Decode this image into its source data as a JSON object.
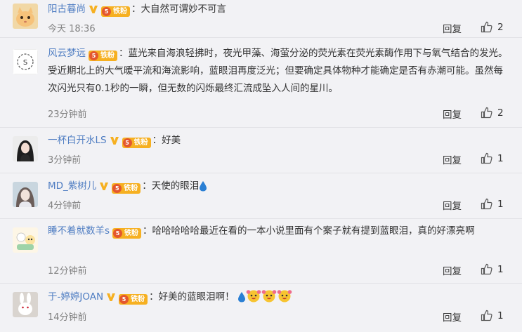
{
  "comments": [
    {
      "user": "阳古暮尚",
      "fan_label": "铁粉",
      "fan_level": "5",
      "text": "大自然可谓妙不可言",
      "time": "今天 18:36",
      "reply_label": "回复",
      "likes": "2",
      "avatar_icon": "cat-avatar"
    },
    {
      "user": "风云梦远",
      "fan_label": "铁粉",
      "fan_level": "5",
      "text": "蓝光来自海浪轻拂时，夜光甲藻、海萤分泌的荧光素在荧光素酶作用下与氧气结合的发光。受近期北上的大气暖平流和海流影响，蓝眼泪再度泛光；但要确定具体物种才能确定是否有赤潮可能。虽然每次闪光只有0.1秒的一瞬，但无数的闪烁最终汇流成坠入人间的星川。",
      "time": "23分钟前",
      "reply_label": "回复",
      "likes": "2",
      "avatar_icon": "logo-avatar"
    },
    {
      "user": "一杯白开水LS",
      "fan_label": "铁粉",
      "fan_level": "5",
      "text": "好美",
      "time": "3分钟前",
      "reply_label": "回复",
      "likes": "1",
      "avatar_icon": "girl-avatar"
    },
    {
      "user": "MD_紫树儿",
      "fan_label": "铁粉",
      "fan_level": "5",
      "text": "天使的眼泪",
      "time": "4分钟前",
      "reply_label": "回复",
      "likes": "1",
      "avatar_icon": "portrait-avatar"
    },
    {
      "user": "睡不着就数羊s",
      "fan_label": "铁粉",
      "fan_level": "5",
      "text": "哈哈哈哈哈最近在看的一本小说里面有个案子就有提到蓝眼泪，真的好漂亮啊",
      "time": "12分钟前",
      "reply_label": "回复",
      "likes": "1",
      "avatar_icon": "cartoon-avatar"
    },
    {
      "user": "于-婷婷JOAN",
      "fan_label": "铁粉",
      "fan_level": "5",
      "text": "好美的蓝眼泪啊！",
      "time": "14分钟前",
      "reply_label": "回复",
      "likes": "1",
      "avatar_icon": "bunny-avatar"
    }
  ],
  "colors": {
    "username": "#4f7dc2",
    "fan_badge": "#f6b021",
    "verified": "#f6b021",
    "teardrop": "#2a7fd4"
  }
}
